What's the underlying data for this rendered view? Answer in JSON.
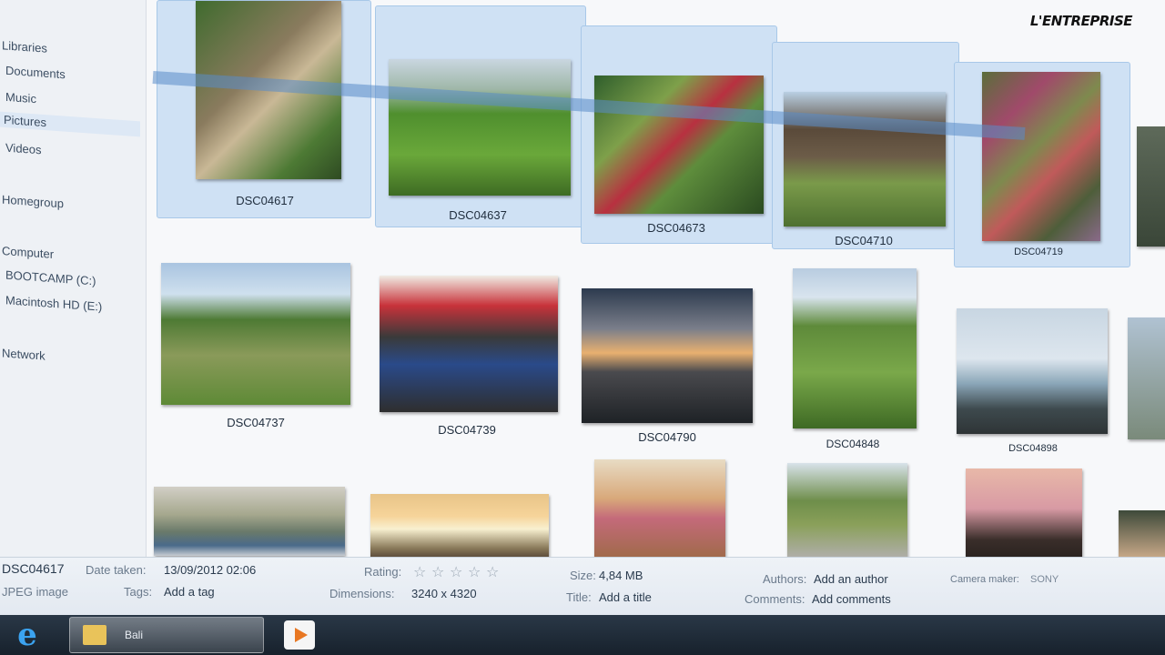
{
  "watermark": "L'ENTREPRISE",
  "nav": {
    "items": [
      {
        "label": "Libraries"
      },
      {
        "label": "Documents"
      },
      {
        "label": "Music"
      },
      {
        "label": "Pictures",
        "selected": true
      },
      {
        "label": "Videos"
      },
      {
        "label": "Homegroup"
      },
      {
        "label": "Computer"
      },
      {
        "label": "BOOTCAMP (C:)"
      },
      {
        "label": "Macintosh HD (E:)"
      },
      {
        "label": "Network"
      }
    ]
  },
  "files": [
    {
      "name": "DSC04617",
      "selected": true
    },
    {
      "name": "DSC04637",
      "selected": true
    },
    {
      "name": "DSC04673",
      "selected": true
    },
    {
      "name": "DSC04710",
      "selected": true
    },
    {
      "name": "DSC04719",
      "selected": true
    },
    {
      "name": "DSC04737"
    },
    {
      "name": "DSC04739"
    },
    {
      "name": "DSC04790"
    },
    {
      "name": "DSC04848"
    },
    {
      "name": "DSC04898"
    }
  ],
  "details": {
    "filename": "DSC04617",
    "filetype": "JPEG image",
    "date_taken_label": "Date taken:",
    "date_taken": "13/09/2012 02:06",
    "tags_label": "Tags:",
    "tags": "Add a tag",
    "rating_label": "Rating:",
    "rating": 0,
    "dimensions_label": "Dimensions:",
    "dimensions": "3240 x 4320",
    "size_label": "Size:",
    "size": "4,84 MB",
    "title_label": "Title:",
    "title": "Add a title",
    "authors_label": "Authors:",
    "authors": "Add an author",
    "comments_label": "Comments:",
    "comments": "Add comments",
    "camera_maker_label": "Camera maker:",
    "camera_maker": "SONY"
  },
  "taskbar": {
    "start_icon": "internet-explorer-icon",
    "explorer_icon": "folder-icon",
    "explorer_label": "Bali",
    "media_icon": "media-player-icon"
  }
}
